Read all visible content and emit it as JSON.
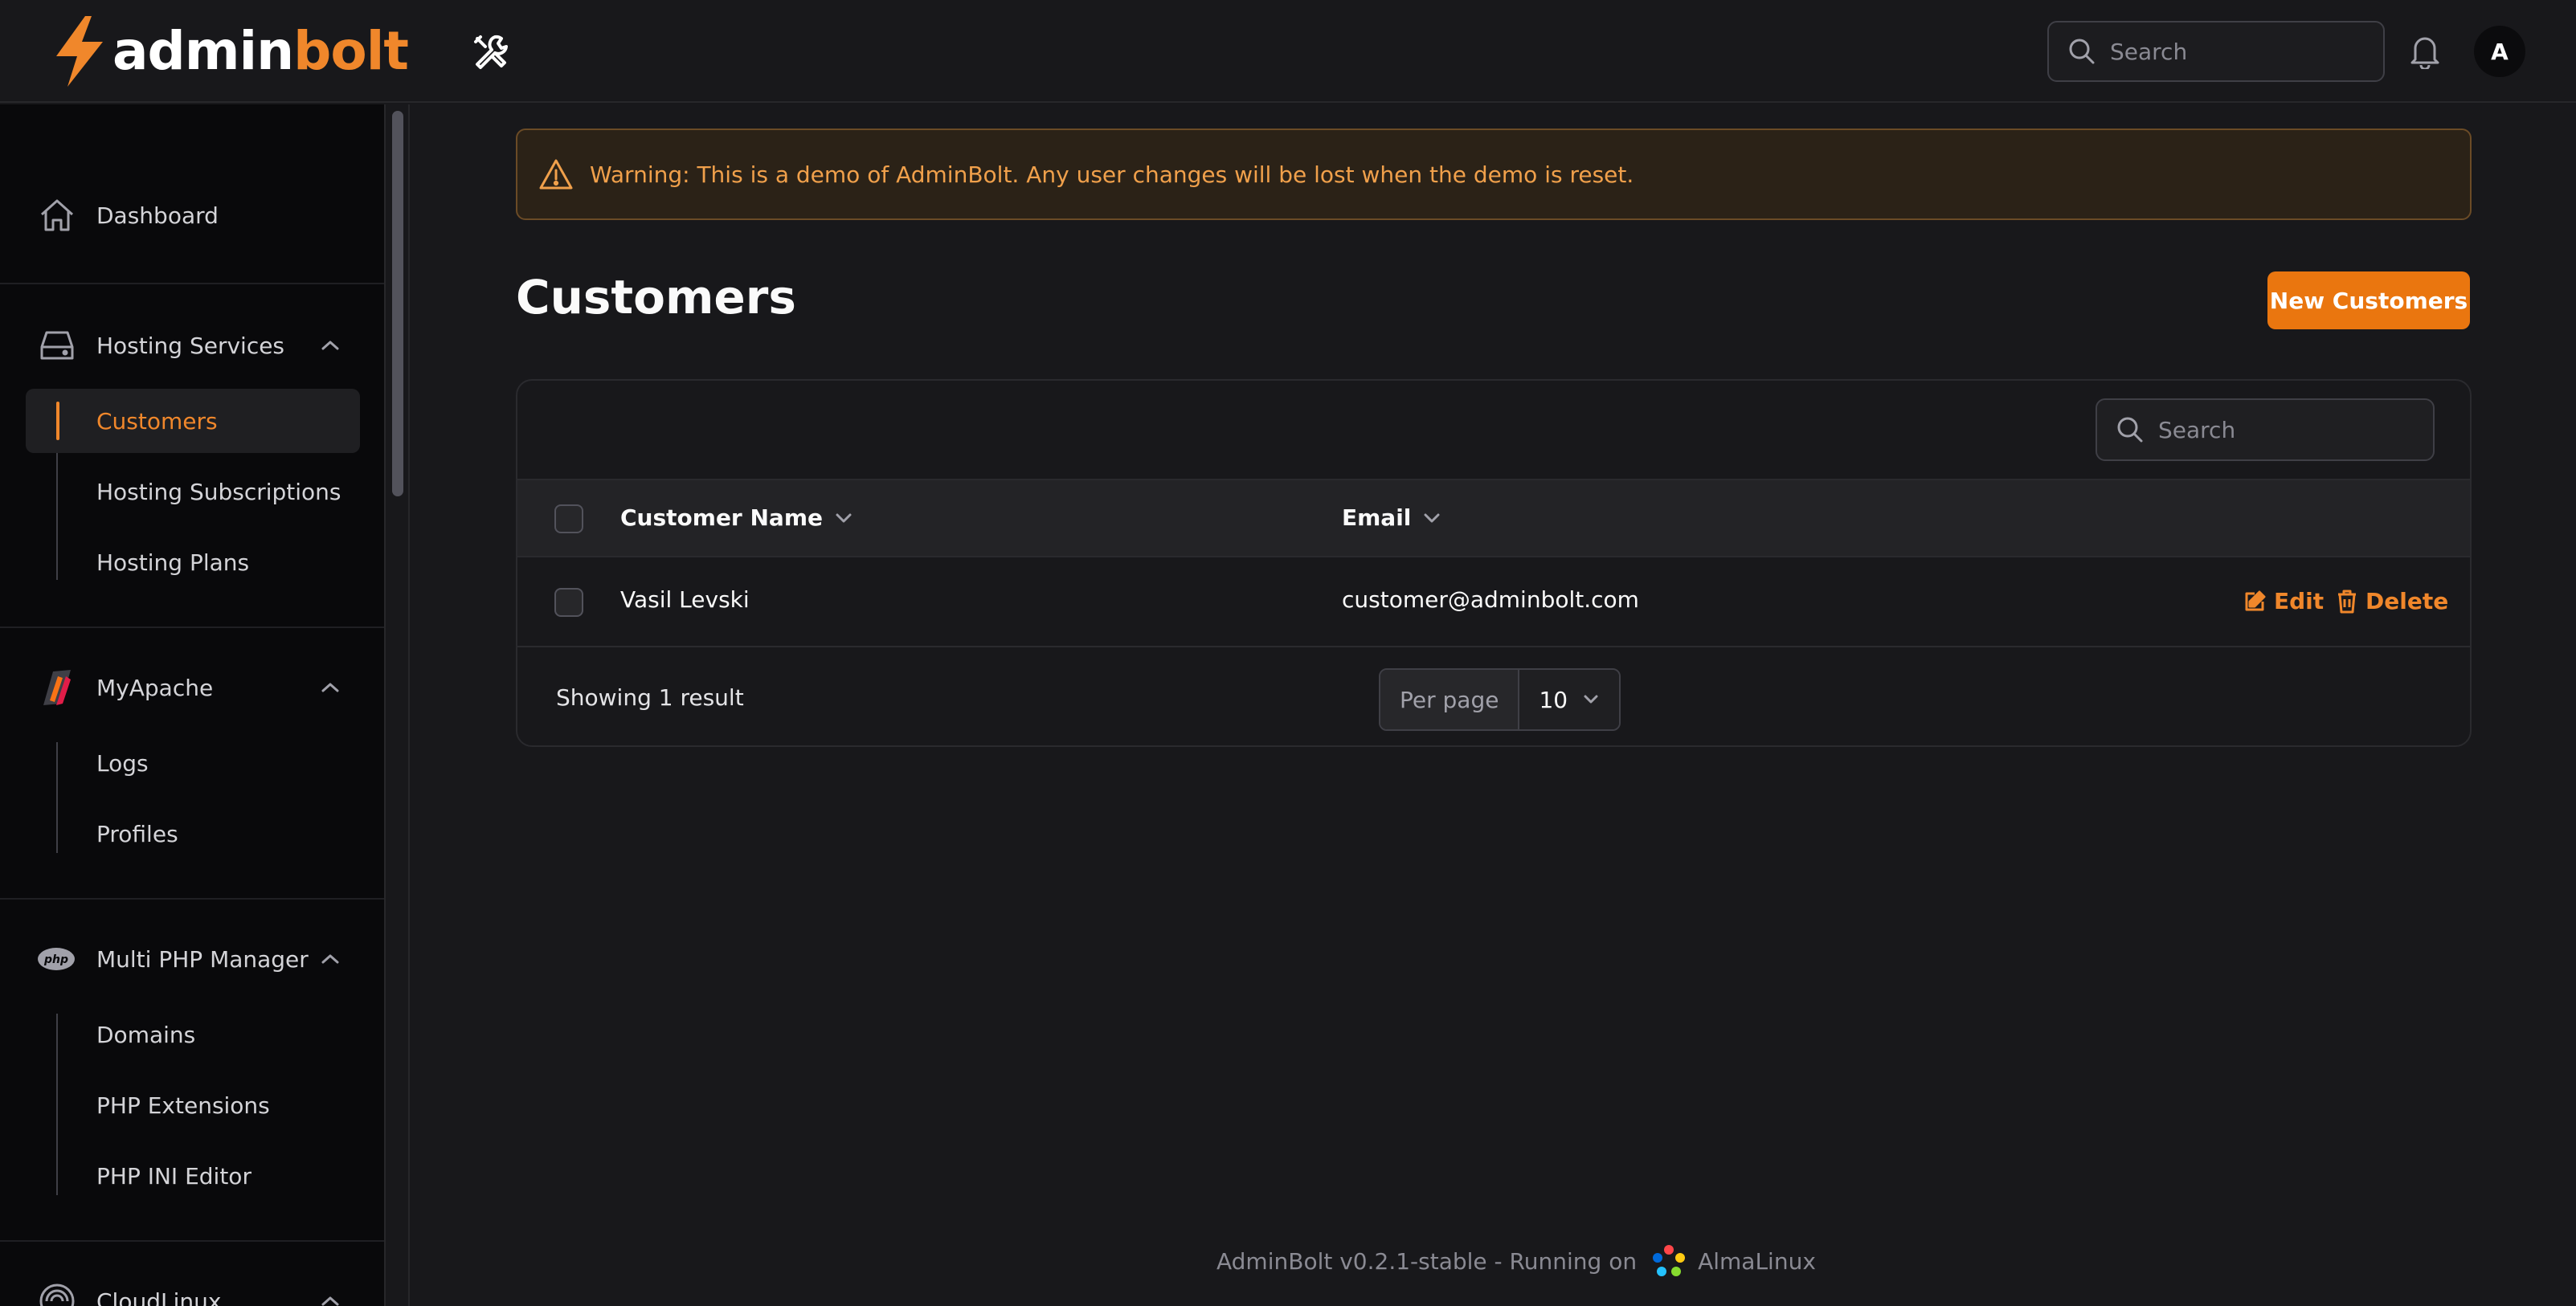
{
  "app": {
    "logo_part1": "admin",
    "logo_part2": "bolt"
  },
  "topbar": {
    "search_placeholder": "Search",
    "avatar_initial": "A"
  },
  "sidebar": {
    "dashboard": "Dashboard",
    "groups": [
      {
        "label": "Hosting Services",
        "items": [
          "Customers",
          "Hosting Subscriptions",
          "Hosting Plans"
        ],
        "active_item": "Customers"
      },
      {
        "label": "MyApache",
        "items": [
          "Logs",
          "Profiles"
        ]
      },
      {
        "label": "Multi PHP Manager",
        "items": [
          "Domains",
          "PHP Extensions",
          "PHP INI Editor"
        ]
      },
      {
        "label": "CloudLinux",
        "items": []
      }
    ]
  },
  "warning": {
    "text": "Warning: This is a demo of AdminBolt. Any user changes will be lost when the demo is reset."
  },
  "page": {
    "title": "Customers",
    "new_button": "New Customers"
  },
  "table": {
    "search_placeholder": "Search",
    "columns": [
      "Customer Name",
      "Email"
    ],
    "rows": [
      {
        "name": "Vasil Levski",
        "email": "customer@adminbolt.com"
      }
    ],
    "actions": {
      "edit": "Edit",
      "delete": "Delete"
    },
    "summary": "Showing 1 result",
    "per_page_label": "Per page",
    "per_page_value": "10"
  },
  "footer": {
    "version_text": "AdminBolt v0.2.1-stable - Running on",
    "os_name": "AlmaLinux"
  },
  "colors": {
    "accent": "#f0872b",
    "background": "#18181b",
    "sidebar": "#09090b",
    "warning_bg": "#2b2217"
  },
  "icons": [
    "bolt-logo-icon",
    "tools-icon",
    "search-icon",
    "bell-icon",
    "home-icon",
    "server-icon",
    "apache-icon",
    "php-icon",
    "cloudlinux-icon",
    "chevron-up-icon",
    "warning-icon",
    "chevron-down-icon",
    "edit-icon",
    "trash-icon",
    "almalinux-icon"
  ]
}
